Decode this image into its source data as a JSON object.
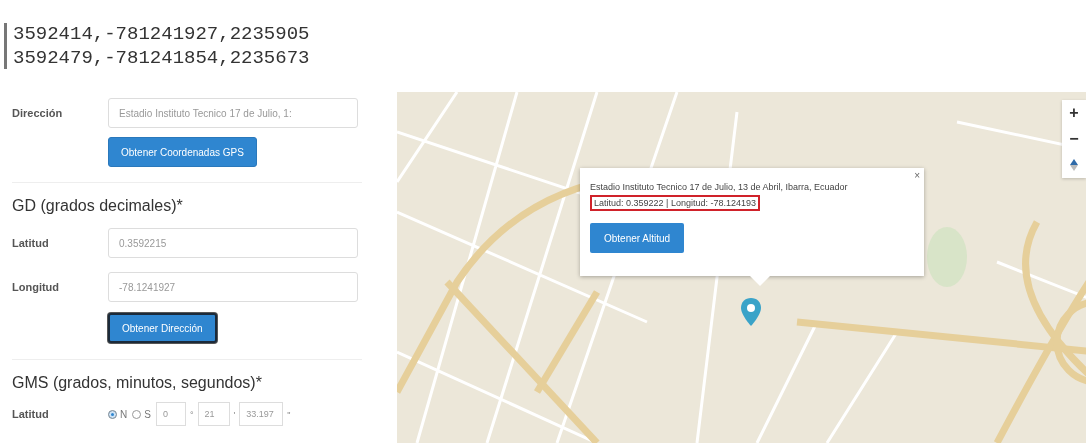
{
  "code_lines": [
    "3592414,-781241927,2235905",
    "3592479,-781241854,2235673"
  ],
  "address": {
    "label": "Dirección",
    "value": "Estadio Instituto Tecnico 17 de Julio, 1:",
    "button": {
      "label": "Obtener Coordenadas GPS",
      "focused": false
    }
  },
  "decimal_degrees": {
    "heading": "GD (grados decimales)*",
    "latitude": {
      "label": "Latitud",
      "value": "0.3592215"
    },
    "longitude": {
      "label": "Longitud",
      "value": "-78.1241927"
    },
    "button": {
      "label": "Obtener Dirección",
      "focused": true
    }
  },
  "dms": {
    "heading": "GMS (grados, minutos, segundos)*",
    "latitude": {
      "label": "Latitud",
      "hemispheres": [
        {
          "label": "N",
          "selected": true
        },
        {
          "label": "S",
          "selected": false
        }
      ],
      "degrees": "0",
      "minutes": "21",
      "seconds": "33.197",
      "symbols": [
        "°",
        "'",
        "\""
      ]
    }
  },
  "map": {
    "popup": {
      "title": "Estadio Instituto Tecnico 17 de Julio, 13 de Abril, Ibarra, Ecuador",
      "coords": "Latitud: 0.359222 | Longitud: -78.124193",
      "button": "Obtener Altitud",
      "close": "×"
    },
    "controls": [
      "+",
      "−"
    ]
  }
}
